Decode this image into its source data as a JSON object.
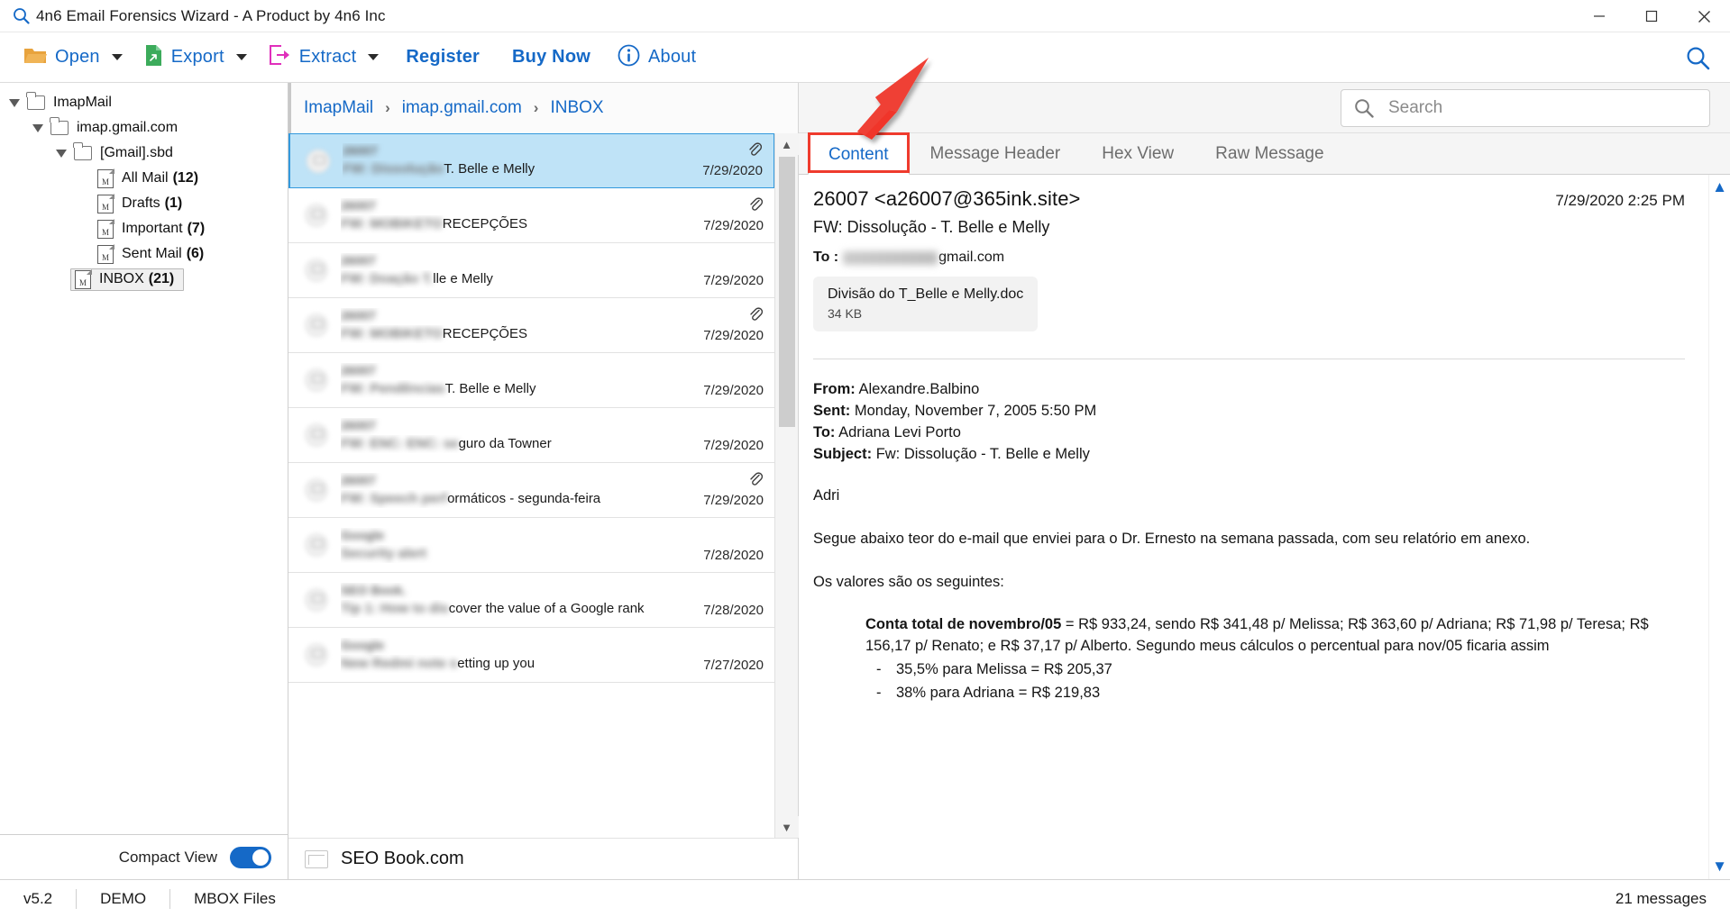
{
  "window": {
    "title": "4n6 Email Forensics Wizard - A Product by 4n6 Inc",
    "app_icon": "magnifier-icon",
    "minimize": "—",
    "maximize": "❐",
    "close": "✕"
  },
  "toolbar": {
    "items": [
      {
        "label": "Open",
        "icon": "open-folder-icon",
        "has_caret": true
      },
      {
        "label": "Export",
        "icon": "export-file-icon",
        "has_caret": true
      },
      {
        "label": "Extract",
        "icon": "extract-icon",
        "has_caret": true
      },
      {
        "label": "Register",
        "icon": "",
        "has_caret": false
      },
      {
        "label": "Buy Now",
        "icon": "",
        "has_caret": false
      },
      {
        "label": "About",
        "icon": "info-icon",
        "has_caret": false
      }
    ],
    "search_icon": "search-icon"
  },
  "sidebar": {
    "tree": [
      {
        "label": "ImapMail",
        "count": "",
        "indent": 0,
        "icon": "folder-icon",
        "expanded": true,
        "selected": false
      },
      {
        "label": "imap.gmail.com",
        "count": "",
        "indent": 1,
        "icon": "folder-icon",
        "expanded": true,
        "selected": false
      },
      {
        "label": "[Gmail].sbd",
        "count": "",
        "indent": 2,
        "icon": "folder-icon",
        "expanded": true,
        "selected": false
      },
      {
        "label": "All Mail",
        "count": "(12)",
        "indent": 3,
        "icon": "mbox-icon",
        "expanded": false,
        "selected": false
      },
      {
        "label": "Drafts",
        "count": "(1)",
        "indent": 3,
        "icon": "mbox-icon",
        "expanded": false,
        "selected": false
      },
      {
        "label": "Important",
        "count": "(7)",
        "indent": 3,
        "icon": "mbox-icon",
        "expanded": false,
        "selected": false
      },
      {
        "label": "Sent Mail",
        "count": "(6)",
        "indent": 3,
        "icon": "mbox-icon",
        "expanded": false,
        "selected": false
      },
      {
        "label": "INBOX",
        "count": "(21)",
        "indent": 2,
        "icon": "mbox-icon",
        "expanded": false,
        "selected": true
      }
    ],
    "compact_view_label": "Compact View",
    "compact_view_on": true
  },
  "breadcrumb": {
    "items": [
      "ImapMail",
      "imap.gmail.com",
      "INBOX"
    ],
    "separator": "›"
  },
  "search": {
    "placeholder": "Search",
    "value": "",
    "icon": "search-icon"
  },
  "maillist": {
    "rows": [
      {
        "sender": "26007",
        "subject_blur": "FW: Dissolução",
        "subject": "T. Belle e Melly",
        "date": "7/29/2020",
        "attachment": true,
        "selected": true
      },
      {
        "sender": "26007",
        "subject_blur": "FW: MOBIKETO",
        "subject": "RECEPÇÕES",
        "date": "7/29/2020",
        "attachment": true,
        "selected": false
      },
      {
        "sender": "26007",
        "subject_blur": "FW: Doação T.",
        "subject": "lle e Melly",
        "date": "7/29/2020",
        "attachment": false,
        "selected": false
      },
      {
        "sender": "26007",
        "subject_blur": "FW: MOBIKETO",
        "subject": "RECEPÇÕES",
        "date": "7/29/2020",
        "attachment": true,
        "selected": false
      },
      {
        "sender": "26007",
        "subject_blur": "FW: Pendências",
        "subject": "T. Belle e Melly",
        "date": "7/29/2020",
        "attachment": false,
        "selected": false
      },
      {
        "sender": "26007",
        "subject_blur": "FW: ENC: ENC: se",
        "subject": "guro da Towner",
        "date": "7/29/2020",
        "attachment": false,
        "selected": false
      },
      {
        "sender": "26007",
        "subject_blur": "FW: Speech  perf",
        "subject": "ormáticos - segunda-feira",
        "date": "7/29/2020",
        "attachment": true,
        "selected": false
      },
      {
        "sender": "Google",
        "subject_blur": "Security alert",
        "subject": "",
        "date": "7/28/2020",
        "attachment": false,
        "selected": false
      },
      {
        "sender": "SEO Book.com",
        "subject_blur": "Tip 1: How to dis",
        "subject": "cover the value of a Google rank",
        "date": "7/28/2020",
        "attachment": false,
        "selected": false
      },
      {
        "sender": "Google",
        "subject_blur": "New Redmi note s",
        "subject": "etting up you",
        "date": "7/27/2020",
        "attachment": false,
        "selected": false
      }
    ],
    "footer_sender": "SEO Book.com"
  },
  "tabs": {
    "items": [
      "Content",
      "Message Header",
      "Hex View",
      "Raw Message"
    ],
    "active": "Content",
    "highlight_color": "#ef3b2d"
  },
  "message": {
    "from": "26007 <a26007@365ink.site>",
    "date": "7/29/2020 2:25 PM",
    "subject": "FW: Dissolução - T. Belle e Melly",
    "to_label": "To :",
    "to_suffix": "gmail.com",
    "attachment": {
      "name": "Divisão do T_Belle e Melly.doc",
      "size": "34 KB",
      "icon": "attachment-chip"
    },
    "quoted_header": [
      {
        "label": "From:",
        "value": "Alexandre.Balbino"
      },
      {
        "label": "Sent:",
        "value": "Monday, November 7, 2005 5:50 PM"
      },
      {
        "label": "To:",
        "value": "Adriana Levi Porto"
      },
      {
        "label": "Subject:",
        "value": "Fw: Dissolução - T. Belle e Melly"
      }
    ],
    "greeting": "Adri",
    "paragraph1": "Segue abaixo teor do e-mail que enviei para o Dr. Ernesto na semana passada, com seu relatório em anexo.",
    "paragraph2": "Os valores são os seguintes:",
    "total_label": "Conta total de novembro/05",
    "total_text": " = R$ 933,24, sendo R$ 341,48 p/ Melissa; R$ 363,60 p/ Adriana; R$ 71,98 p/ Teresa; R$ 156,17 p/ Renato; e R$ 37,17 p/ Alberto. Segundo meus cálculos o percentual para nov/05 ficaria assim",
    "items": [
      {
        "dash": "-",
        "text": "35,5% para Melissa = R$ 205,37"
      },
      {
        "dash": "-",
        "text": "38% para Adriana = R$ 219,83"
      }
    ]
  },
  "statusbar": {
    "version": "v5.2",
    "license": "DEMO",
    "filetype": "MBOX Files",
    "message_count": "21 messages"
  },
  "colors": {
    "accent_blue": "#1569c7",
    "selection_blue": "#bfe3f7",
    "annotation_red": "#ef3b2d",
    "folder_orange": "#e8a33d",
    "export_green": "#3cab5b",
    "extract_magenta": "#e02fbb"
  }
}
